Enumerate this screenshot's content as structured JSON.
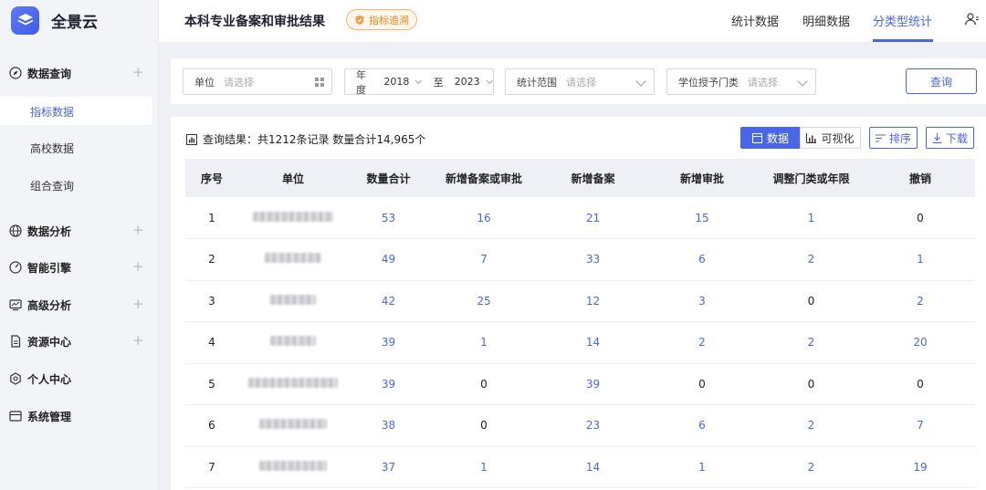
{
  "app": {
    "name": "全景云"
  },
  "sidebar": {
    "items": [
      {
        "label": "数据查询",
        "icon": "compass-icon",
        "expandable": true
      },
      {
        "label": "指标数据",
        "sub": true,
        "active": true
      },
      {
        "label": "高校数据",
        "sub": true
      },
      {
        "label": "组合查询",
        "sub": true
      },
      {
        "label": "数据分析",
        "icon": "globe-icon",
        "expandable": true
      },
      {
        "label": "智能引擎",
        "icon": "gauge-icon",
        "expandable": true
      },
      {
        "label": "高级分析",
        "icon": "monitor-chart-icon",
        "expandable": true
      },
      {
        "label": "资源中心",
        "icon": "document-icon",
        "expandable": true
      },
      {
        "label": "个人中心",
        "icon": "gear-icon",
        "expandable": false
      },
      {
        "label": "系统管理",
        "icon": "layout-icon",
        "expandable": false
      }
    ],
    "expand_symbol": "+"
  },
  "header": {
    "title": "本科专业备案和审批结果",
    "badge": "指标追溯",
    "tabs": [
      "统计数据",
      "明细数据",
      "分类型统计"
    ],
    "active_tab": "分类型统计"
  },
  "filters": {
    "unit": {
      "label": "单位",
      "placeholder": "请选择"
    },
    "year": {
      "label": "年度",
      "from": "2018",
      "to_sep": "至",
      "to": "2023"
    },
    "scope": {
      "label": "统计范围",
      "placeholder": "请选择"
    },
    "degree": {
      "label": "学位授予门类",
      "placeholder": "请选择"
    },
    "query_label": "查询"
  },
  "results": {
    "summary": "查询结果：共1212条记录  数量合计14,965个",
    "view_data": "数据",
    "view_chart": "可视化",
    "sort": "排序",
    "download": "下载"
  },
  "table": {
    "headers": [
      "序号",
      "单位",
      "数量合计",
      "新增备案或审批",
      "新增备案",
      "新增审批",
      "调整门类或年限",
      "撤销"
    ],
    "rows": [
      {
        "idx": "1",
        "total": "53",
        "new_any": "16",
        "new_filing": "21",
        "new_approval": "15",
        "adjust": "1",
        "revoke": "0"
      },
      {
        "idx": "2",
        "total": "49",
        "new_any": "7",
        "new_filing": "33",
        "new_approval": "6",
        "adjust": "2",
        "revoke": "1"
      },
      {
        "idx": "3",
        "total": "42",
        "new_any": "25",
        "new_filing": "12",
        "new_approval": "3",
        "adjust": "0",
        "revoke": "2"
      },
      {
        "idx": "4",
        "total": "39",
        "new_any": "1",
        "new_filing": "14",
        "new_approval": "2",
        "adjust": "2",
        "revoke": "20"
      },
      {
        "idx": "5",
        "total": "39",
        "new_any": "0",
        "new_filing": "39",
        "new_approval": "0",
        "adjust": "0",
        "revoke": "0"
      },
      {
        "idx": "6",
        "total": "38",
        "new_any": "0",
        "new_filing": "23",
        "new_approval": "6",
        "adjust": "2",
        "revoke": "7"
      },
      {
        "idx": "7",
        "total": "37",
        "new_any": "1",
        "new_filing": "14",
        "new_approval": "1",
        "adjust": "2",
        "revoke": "19"
      }
    ]
  },
  "colors": {
    "accent": "#4a66e8",
    "badge": "#e58b1e",
    "header_bg": "#eef0f6"
  }
}
